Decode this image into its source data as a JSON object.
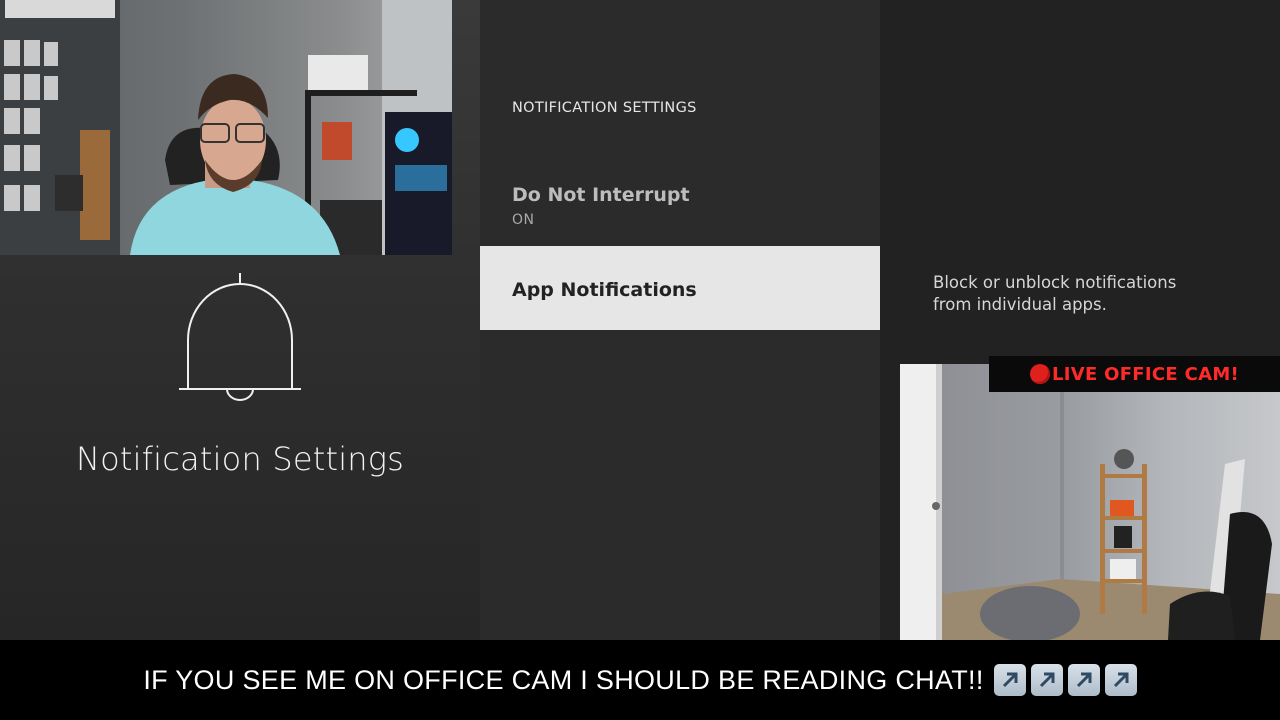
{
  "left": {
    "title": "Notification Settings",
    "icon": "bell-icon"
  },
  "menu": {
    "header": "NOTIFICATION SETTINGS",
    "items": [
      {
        "label": "Do Not Interrupt",
        "value": "ON",
        "selected": false
      },
      {
        "label": "App Notifications",
        "selected": true
      }
    ]
  },
  "detail": {
    "description_line1": "Block or unblock notifications",
    "description_line2": "from individual apps."
  },
  "overlay": {
    "live_label": "LIVE OFFICE CAM!",
    "live_icon": "red-circle-icon",
    "banner_text": "IF YOU SEE ME ON OFFICE CAM I SHOULD BE READING CHAT!!",
    "banner_icon": "up-right-arrow-icon",
    "banner_icon_count": 4
  },
  "colors": {
    "selected_bg": "#e6e6e6",
    "live_red": "#ff2b2b"
  }
}
